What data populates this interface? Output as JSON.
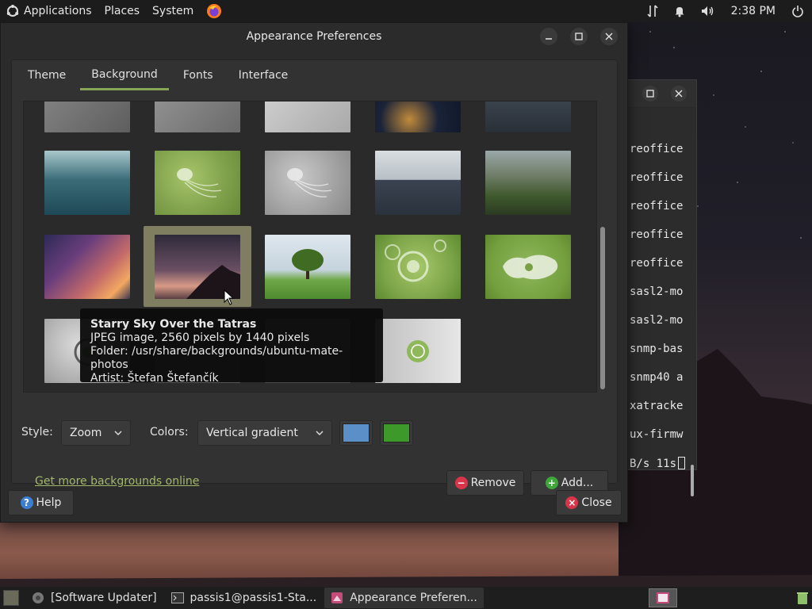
{
  "top_panel": {
    "menus": [
      "Applications",
      "Places",
      "System"
    ],
    "clock": "2:38 PM",
    "icons": [
      "ubuntu-mate-logo-icon",
      "firefox-icon",
      "network-icon",
      "notification-bell-icon",
      "volume-icon",
      "power-icon"
    ]
  },
  "terminal": {
    "lines": [
      "reoffice",
      "reoffice",
      "reoffice",
      "reoffice",
      "reoffice",
      "sasl2-mo",
      "sasl2-mo",
      "snmp-bas",
      "snmp40 a",
      "xatracke",
      "ux-firmw",
      "B/s 11s"
    ]
  },
  "dialog": {
    "title": "Appearance Preferences",
    "tabs": [
      "Theme",
      "Background",
      "Fonts",
      "Interface"
    ],
    "active_tab": "Background",
    "tooltip": {
      "title": "Starry Sky Over the Tatras",
      "line1": "JPEG image, 2560 pixels by 1440 pixels",
      "line2": "Folder: /usr/share/backgrounds/ubuntu-mate-photos",
      "line3": "Artist: Štefan Štefančík"
    },
    "style_label": "Style:",
    "style_value": "Zoom",
    "colors_label": "Colors:",
    "colors_value": "Vertical gradient",
    "color_primary": "#5b8fc7",
    "color_secondary": "#3d9a2a",
    "more_link": "Get more backgrounds online",
    "remove_label": "Remove",
    "add_label": "Add...",
    "help_label": "Help",
    "close_label": "Close",
    "accent": "#87a556"
  },
  "taskbar": {
    "tasks": [
      "[Software Updater]",
      "passis1@passis1-Sta...",
      "Appearance Preferen..."
    ]
  }
}
